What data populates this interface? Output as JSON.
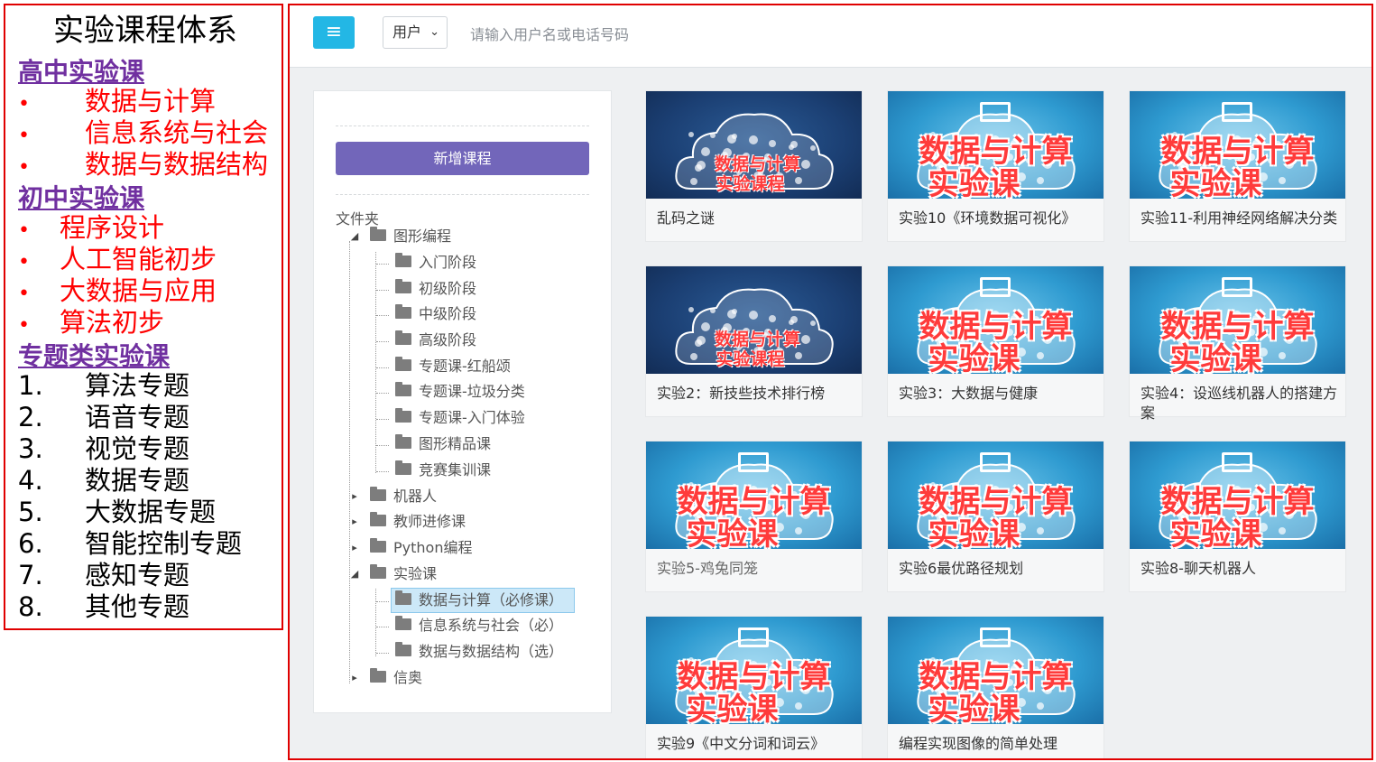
{
  "outline": {
    "title": "实验课程体系",
    "sections": [
      {
        "heading": "高中实验课",
        "style": "bullet",
        "items": [
          "数据与计算",
          "信息系统与社会",
          "数据与数据结构"
        ]
      },
      {
        "heading": "初中实验课",
        "style": "bullet",
        "items": [
          "程序设计",
          "人工智能初步",
          "大数据与应用",
          "算法初步"
        ]
      },
      {
        "heading": "专题类实验课",
        "style": "numbered",
        "items": [
          {
            "num": "1.",
            "label": "算法专题"
          },
          {
            "num": "2.",
            "label": "语音专题"
          },
          {
            "num": "3.",
            "label": "视觉专题"
          },
          {
            "num": "4.",
            "label": "数据专题"
          },
          {
            "num": "5.",
            "label": "大数据专题"
          },
          {
            "num": "6.",
            "label": "智能控制专题"
          },
          {
            "num": "7.",
            "label": "感知专题"
          },
          {
            "num": "8.",
            "label": "其他专题"
          }
        ]
      }
    ]
  },
  "toolbar": {
    "menu_icon": "≡",
    "user_select": "用户",
    "search_placeholder": "请输入用户名或电话号码"
  },
  "sidebar": {
    "add_course": "新增课程",
    "folder_label": "文件夹",
    "tree": [
      {
        "label": "图形编程",
        "expanded": true,
        "children": [
          "入门阶段",
          "初级阶段",
          "中级阶段",
          "高级阶段",
          "专题课-红船颂",
          "专题课-垃圾分类",
          "专题课-入门体验",
          "图形精品课",
          "竞赛集训课"
        ]
      },
      {
        "label": "机器人",
        "expanded": false
      },
      {
        "label": "教师进修课",
        "expanded": false
      },
      {
        "label": "Python编程",
        "expanded": false
      },
      {
        "label": "实验课",
        "expanded": true,
        "children": [
          "数据与计算（必修课）",
          "信息系统与社会（必）",
          "数据与数据结构（选）"
        ]
      },
      {
        "label": "信奥",
        "expanded": false
      }
    ],
    "selected": "数据与计算（必修课）"
  },
  "courses": [
    {
      "title": "乱码之谜",
      "thumb": "navy",
      "line1": "数据与计算",
      "line2": "实验课程"
    },
    {
      "title": "实验10《环境数据可视化》",
      "thumb": "blue",
      "line1": "数据与计算",
      "line2": "实验课"
    },
    {
      "title": "实验11-利用神经网络解决分类",
      "thumb": "blue",
      "line1": "数据与计算",
      "line2": "实验课"
    },
    {
      "title": "实验2：新技些技术排行榜",
      "thumb": "navy",
      "line1": "数据与计算",
      "line2": "实验课程"
    },
    {
      "title": "实验3：大数据与健康",
      "thumb": "blue",
      "line1": "数据与计算",
      "line2": "实验课"
    },
    {
      "title": "实验4：设巡线机器人的搭建方案",
      "thumb": "blue",
      "line1": "数据与计算",
      "line2": "实验课"
    },
    {
      "title": "实验5-鸡兔同笼",
      "thumb": "blue",
      "line1": "数据与计算",
      "line2": "实验课"
    },
    {
      "title": "实验6最优路径规划",
      "thumb": "blue",
      "line1": "数据与计算",
      "line2": "实验课"
    },
    {
      "title": "实验8-聊天机器人",
      "thumb": "blue",
      "line1": "数据与计算",
      "line2": "实验课"
    },
    {
      "title": "实验9《中文分词和词云》",
      "thumb": "blue",
      "line1": "数据与计算",
      "line2": "实验课"
    },
    {
      "title": "编程实现图像的简单处理",
      "thumb": "blue",
      "line1": "数据与计算",
      "line2": "实验课"
    }
  ],
  "colors": {
    "frame_border": "#e00000",
    "accent": "#23b7e5",
    "add_button": "#7266ba",
    "heading": "#7030a0",
    "bullet_text": "#ff0000"
  }
}
